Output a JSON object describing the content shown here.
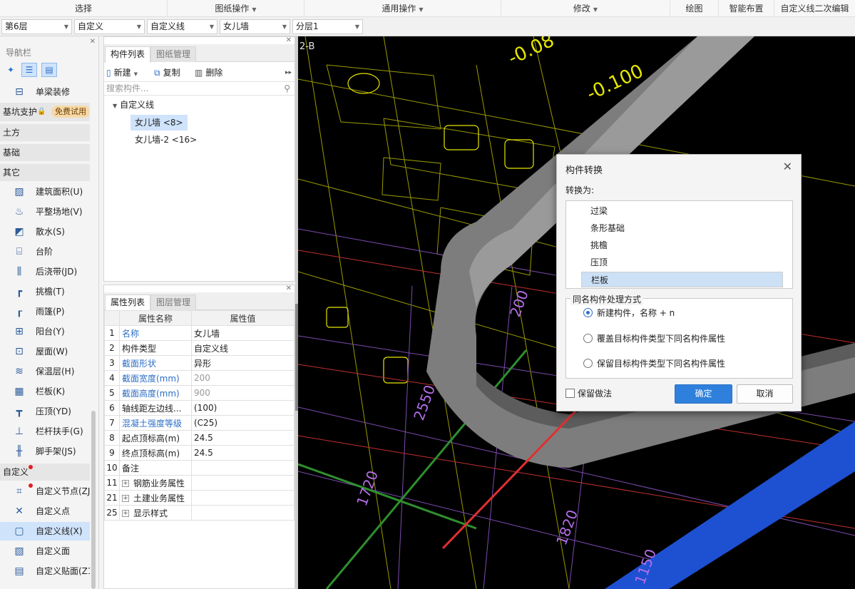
{
  "ribbon": {
    "select": "选择",
    "drawing_ops": "图纸操作",
    "common_ops": "通用操作",
    "modify": "修改",
    "draw": "绘图",
    "smart_layout": "智能布置",
    "custom_line_edit": "自定义线二次编辑"
  },
  "selectors": {
    "floor": "第6层",
    "category": "自定义",
    "type": "自定义线",
    "component": "女儿墙",
    "layer": "分层1"
  },
  "nav": {
    "title": "导航栏",
    "items_top": [
      {
        "icon": "beam-decoration-icon",
        "label": "单梁装修"
      }
    ],
    "pit_support": "基坑支护",
    "free_trial": "免费试用",
    "categories": {
      "earthwork": "土方",
      "foundation": "基础",
      "other": "其它",
      "custom": "自定义"
    },
    "other_items": [
      {
        "icon": "building-area-icon",
        "label": "建筑面积(U)"
      },
      {
        "icon": "site-leveling-icon",
        "label": "平整场地(V)"
      },
      {
        "icon": "apron-icon",
        "label": "散水(S)"
      },
      {
        "icon": "steps-icon",
        "label": "台阶"
      },
      {
        "icon": "post-pour-strip-icon",
        "label": "后浇带(JD)"
      },
      {
        "icon": "eaves-icon",
        "label": "挑檐(T)"
      },
      {
        "icon": "canopy-icon",
        "label": "雨篷(P)"
      },
      {
        "icon": "balcony-icon",
        "label": "阳台(Y)"
      },
      {
        "icon": "roof-icon",
        "label": "屋面(W)"
      },
      {
        "icon": "insulation-icon",
        "label": "保温层(H)"
      },
      {
        "icon": "parapet-panel-icon",
        "label": "栏板(K)"
      },
      {
        "icon": "coping-icon",
        "label": "压顶(YD)"
      },
      {
        "icon": "railing-icon",
        "label": "栏杆扶手(G)"
      },
      {
        "icon": "scaffold-icon",
        "label": "脚手架(JS)"
      }
    ],
    "custom_items": [
      {
        "icon": "custom-node-icon",
        "label": "自定义节点(ZJ"
      },
      {
        "icon": "custom-point-icon",
        "label": "自定义点"
      },
      {
        "icon": "custom-line-icon",
        "label": "自定义线(X)"
      },
      {
        "icon": "custom-face-icon",
        "label": "自定义面"
      },
      {
        "icon": "custom-patch-icon",
        "label": "自定义贴面(Z1"
      }
    ]
  },
  "complist": {
    "tabs": [
      "构件列表",
      "图纸管理"
    ],
    "new_label": "新建",
    "copy_label": "复制",
    "delete_label": "删除",
    "search_placeholder": "搜索构件...",
    "tree_root": "自定义线",
    "tree_items": [
      "女儿墙 <8>",
      "女儿墙-2 <16>"
    ]
  },
  "props": {
    "tabs": [
      "属性列表",
      "图层管理"
    ],
    "col_name": "属性名称",
    "col_value": "属性值",
    "rows": [
      {
        "num": "1",
        "name": "名称",
        "value": "女儿墙"
      },
      {
        "num": "2",
        "name": "构件类型",
        "value": "自定义线"
      },
      {
        "num": "3",
        "name": "截面形状",
        "value": "异形"
      },
      {
        "num": "4",
        "name": "截面宽度(mm)",
        "value": "200"
      },
      {
        "num": "5",
        "name": "截面高度(mm)",
        "value": "900"
      },
      {
        "num": "6",
        "name": "轴线距左边线...",
        "value": "(100)"
      },
      {
        "num": "7",
        "name": "混凝土强度等级",
        "value": "(C25)"
      },
      {
        "num": "8",
        "name": "起点顶标高(m)",
        "value": "24.5"
      },
      {
        "num": "9",
        "name": "终点顶标高(m)",
        "value": "24.5"
      },
      {
        "num": "10",
        "name": "备注",
        "value": ""
      },
      {
        "num": "11",
        "name": "钢筋业务属性",
        "value": ""
      },
      {
        "num": "21",
        "name": "土建业务属性",
        "value": ""
      },
      {
        "num": "25",
        "name": "显示样式",
        "value": ""
      }
    ]
  },
  "canvas": {
    "labels": [
      "-0.08",
      "-0.100",
      "2-B",
      "200",
      "2550",
      "1720",
      "1820",
      "1150"
    ]
  },
  "dialog": {
    "title": "构件转换",
    "convert_to": "转换为:",
    "types": [
      "过梁",
      "条形基础",
      "挑檐",
      "压顶",
      "栏板"
    ],
    "selected_type": "栏板",
    "group_title": "同名构件处理方式",
    "options": [
      "新建构件，名称 + n",
      "覆盖目标构件类型下同名构件属性",
      "保留目标构件类型下同名构件属性"
    ],
    "selected_option": 0,
    "keep_method": "保留做法",
    "ok": "确定",
    "cancel": "取消"
  },
  "colors": {
    "accent": "#2f80dc",
    "selection": "#cfe3fb",
    "canvas_bg": "#000000",
    "cad_yellow": "#e6e600",
    "cad_green": "#33cc33",
    "cad_violet": "#b46ee6",
    "wall_gray": "#8c8c8c",
    "slab_blue": "#1e50d2",
    "arrow_red": "#e03030"
  }
}
